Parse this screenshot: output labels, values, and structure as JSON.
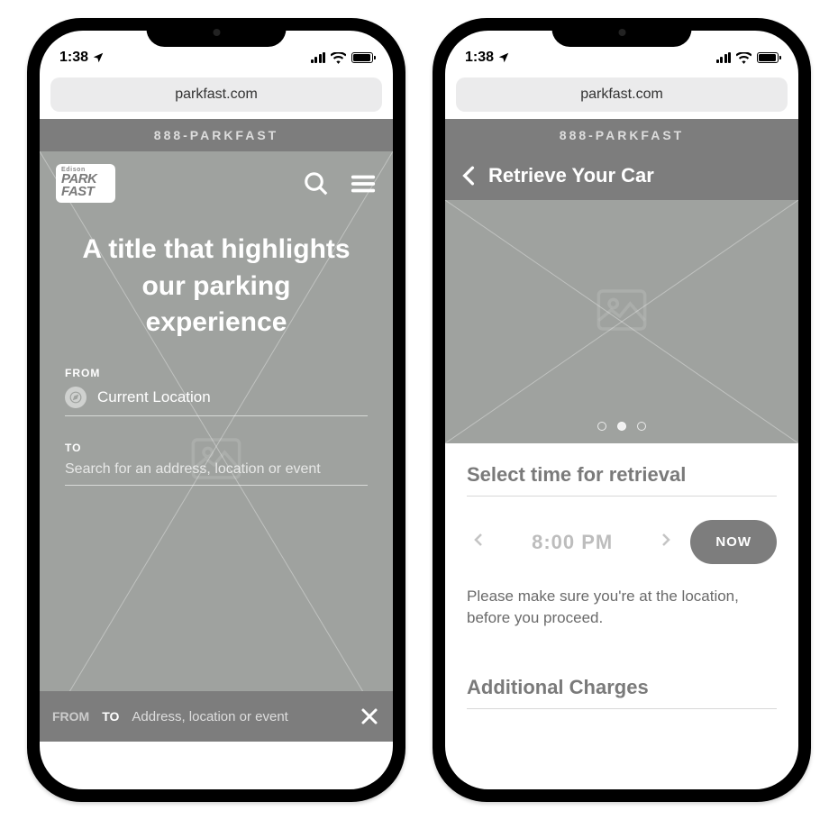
{
  "status": {
    "time": "1:38"
  },
  "browser": {
    "url": "parkfast.com"
  },
  "banner": {
    "phone": "888-PARKFAST"
  },
  "logo": {
    "brand_small": "Edison",
    "line1": "PARK",
    "line2": "FAST"
  },
  "hero": {
    "title": "A title that highlights our parking experience"
  },
  "form": {
    "from_label": "FROM",
    "from_value": "Current Location",
    "to_label": "TO",
    "to_placeholder": "Search for an address, location or event"
  },
  "sticky": {
    "tab_from": "FROM",
    "tab_to": "TO",
    "placeholder": "Address, location or event"
  },
  "screen2": {
    "page_title": "Retrieve Your Car",
    "section_title": "Select time for retrieval",
    "time_value": "8:00 PM",
    "now_label": "NOW",
    "helper": "Please make sure you're at the location, before you proceed.",
    "charges_title": "Additional Charges"
  }
}
